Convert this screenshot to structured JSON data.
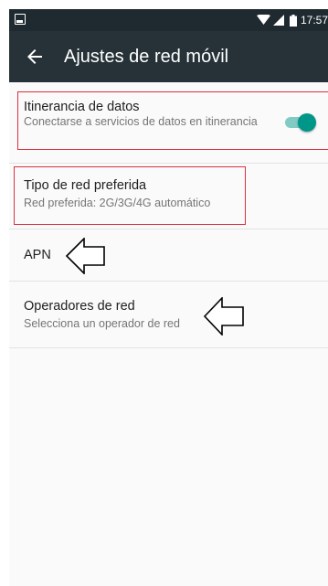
{
  "status_bar": {
    "time": "17:57",
    "icons": [
      "image-notification-icon",
      "wifi-icon",
      "signal-icon",
      "battery-icon"
    ]
  },
  "app_bar": {
    "back_icon": "arrow-left-icon",
    "title": "Ajustes de red móvil"
  },
  "settings": {
    "roaming": {
      "title": "Itinerancia de datos",
      "summary": "Conectarse a servicios de datos en itinerancia",
      "toggle_on": true
    },
    "network_type": {
      "title": "Tipo de red preferida",
      "summary": "Red preferida: 2G/3G/4G automático"
    },
    "apn": {
      "title": "APN"
    },
    "operators": {
      "title": "Operadores de red",
      "summary": "Selecciona un operador de red"
    }
  },
  "colors": {
    "app_bar": "#263238",
    "status_bar": "#1f2a30",
    "accent": "#009688",
    "highlight_box": "#d9303e"
  }
}
